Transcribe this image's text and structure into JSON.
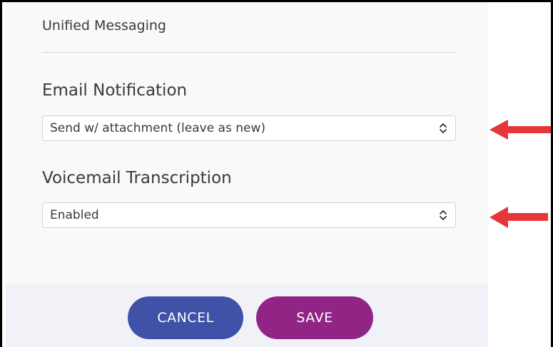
{
  "section": {
    "title": "Unified Messaging"
  },
  "email_notification": {
    "label": "Email Notification",
    "selected": "Send w/ attachment (leave as new)"
  },
  "voicemail_transcription": {
    "label": "Voicemail Transcription",
    "selected": "Enabled"
  },
  "actions": {
    "cancel_label": "CANCEL",
    "save_label": "SAVE"
  },
  "colors": {
    "cancel": "#3f52a8",
    "save": "#922486",
    "annotation_arrow": "#e5363a"
  }
}
